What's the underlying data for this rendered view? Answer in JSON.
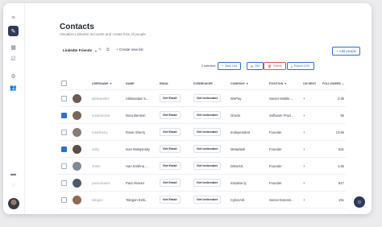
{
  "page": {
    "title": "Contacts",
    "subtitle": "Visualize LinkedIn accounts and create lists of people"
  },
  "toolbar": {
    "list_selected": "LinkedIn Friends",
    "new_list": "Create new list",
    "add_people": "Add people"
  },
  "selection": {
    "count_text": "2 selected",
    "new_list": "New List",
    "dm": "DM",
    "delete": "Delete",
    "export": "Export CSV"
  },
  "table": {
    "headers": [
      "USERNAME",
      "NAME",
      "EMAIL",
      "ICEBREAKER",
      "COMPANY",
      "POSITION",
      "CM SENT",
      "FOLLOWERS"
    ],
    "rows": [
      {
        "checked": false,
        "username": "aleksandert",
        "name": "Aleksandar S...",
        "email": "Get Email",
        "icebreaker": "Get Icebreaker",
        "company": "WePay",
        "position": "Senior Mobile ...",
        "cm": "+",
        "followers": "2.3k"
      },
      {
        "checked": true,
        "username": "norabenson",
        "name": "Nora Benson",
        "email": "Get Email",
        "icebreaker": "Get Icebreaker",
        "company": "Oracle",
        "position": "Software Prod...",
        "cm": "+",
        "followers": "5k"
      },
      {
        "checked": false,
        "username": "rosesherry",
        "name": "Rosie Sherry",
        "email": "Get Email",
        "icebreaker": "Get Icebreaker",
        "company": "Indiependent",
        "position": "Founder",
        "cm": "+",
        "followers": "13.6k"
      },
      {
        "checked": true,
        "username": "ivsky",
        "name": "Ivan Malopinsky",
        "email": "Get Email",
        "icebreaker": "Get Icebreaker",
        "company": "Metadash",
        "position": "Founder",
        "cm": "+",
        "followers": "631"
      },
      {
        "checked": false,
        "username": "1hahr",
        "name": "Hari Krishna ...",
        "email": "Get Email",
        "icebreaker": "Get Icebreaker",
        "company": "DWorkS",
        "position": "Founder",
        "cm": "+",
        "followers": "1.5k"
      },
      {
        "checked": false,
        "username": "paul-alvarez",
        "name": "Paul Alvarez",
        "email": "Get Email",
        "icebreaker": "Get Icebreaker",
        "company": "Initiative.ly",
        "position": "Founder",
        "cm": "+",
        "followers": "817"
      },
      {
        "checked": false,
        "username": "tologon",
        "name": "Tologon Eshi...",
        "email": "Get Email",
        "icebreaker": "Get Icebreaker",
        "company": "CyberArk",
        "position": "Senior Extensi...",
        "cm": "+",
        "followers": "151"
      }
    ]
  },
  "colors": {
    "accent": "#2c6fd6",
    "danger": "#d9534f",
    "nav_active": "#2f3a5a"
  },
  "icons": {
    "rail": [
      "menu-icon",
      "edit-icon",
      "grid-icon",
      "check-square-icon",
      "settings-icon",
      "people-icon",
      "folder-icon",
      "chat-icon"
    ],
    "fab": "chat-icon"
  }
}
